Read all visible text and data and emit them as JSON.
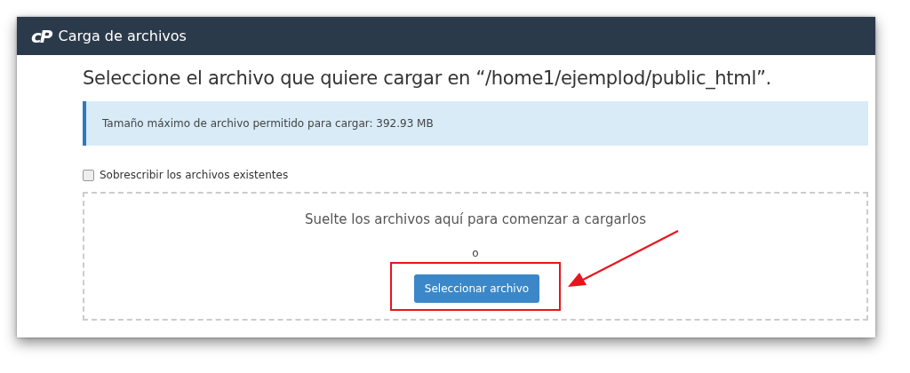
{
  "window": {
    "logo": "cP",
    "title": "Carga de archivos"
  },
  "heading": "Seleccione el archivo que quiere cargar en “/home1/ejemplod/public_html”.",
  "info": "Tamaño máximo de archivo permitido para cargar: 392.93 MB",
  "overwrite": {
    "label": "Sobrescribir los archivos existentes",
    "checked": false
  },
  "dropzone": {
    "prompt": "Suelte los archivos aquí para comenzar a cargarlos",
    "separator": "o",
    "button": "Seleccionar archivo"
  }
}
